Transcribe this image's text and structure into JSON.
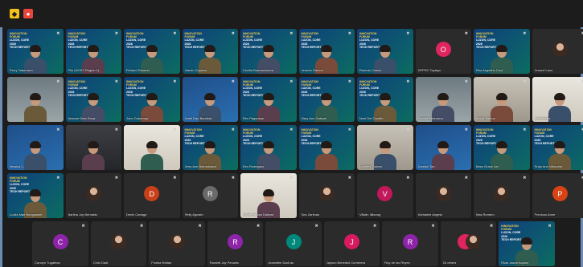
{
  "toolbar": {
    "shield_icon": "shield-icon",
    "record_icon": "record-icon"
  },
  "forum_banner": {
    "line1": "INNOVATION FORUM",
    "line2": "LUZON, CORE 2026",
    "line3": "TECH REPORT"
  },
  "rows": [
    [
      {
        "name": "Perry Tabernero",
        "type": "video",
        "bg": "forum"
      },
      {
        "name": "Pilo (DOST-Region 1)",
        "type": "video",
        "bg": "forum"
      },
      {
        "name": "Richard Rosario",
        "type": "video",
        "bg": "forum"
      },
      {
        "name": "Marvin Goyena",
        "type": "video",
        "bg": "forum"
      },
      {
        "name": "Cecilia Buenaventura",
        "type": "video",
        "bg": "forum"
      },
      {
        "name": "Jerome Ramos",
        "type": "video",
        "bg": "forum"
      },
      {
        "name": "Roberto Castro",
        "type": "video",
        "bg": "forum"
      },
      {
        "name": "DPPRC Taytayo",
        "type": "avatar",
        "letter": "O",
        "color": "#e0245e"
      },
      {
        "name": "Rea Angeline Cruz",
        "type": "video",
        "bg": "forum"
      },
      {
        "name": "Jemuel Lazo",
        "type": "photo"
      }
    ],
    [
      {
        "name": "",
        "type": "video",
        "bg": "room"
      },
      {
        "name": "Arianne Dela Rosa",
        "type": "video",
        "bg": "forum"
      },
      {
        "name": "John Caburnay",
        "type": "video",
        "bg": "forum"
      },
      {
        "name": "Jeriel Dan Bautista",
        "type": "video",
        "bg": "blue"
      },
      {
        "name": "Rex Pagsuban",
        "type": "video",
        "bg": "forum"
      },
      {
        "name": "Mary Ann Gabuat",
        "type": "video",
        "bg": "forum"
      },
      {
        "name": "Noel Del Castillo",
        "type": "video",
        "bg": "forum"
      },
      {
        "name": "Rachel Villanueva",
        "type": "video",
        "bg": "room"
      },
      {
        "name": "Maria Santos",
        "type": "video",
        "bg": "office"
      },
      {
        "name": "Ana Reyes",
        "type": "video",
        "bg": "light"
      }
    ],
    [
      {
        "name": "Jessica L.",
        "type": "video",
        "bg": "blue"
      },
      {
        "name": "",
        "type": "video",
        "bg": "dark"
      },
      {
        "name": "",
        "type": "video",
        "bg": "light"
      },
      {
        "name": "Jerry Ann Batumbakal",
        "type": "video",
        "bg": "forum"
      },
      {
        "name": "Kim Rodriguez",
        "type": "video",
        "bg": "forum"
      },
      {
        "name": "",
        "type": "video",
        "bg": "forum"
      },
      {
        "name": "Lourdes Galvez",
        "type": "video",
        "bg": "office"
      },
      {
        "name": "Jocelyn Tan",
        "type": "video",
        "bg": "blue"
      },
      {
        "name": "Mary Grace Lim",
        "type": "video",
        "bg": "forum"
      },
      {
        "name": "Ruby Ann Villacorta",
        "type": "video",
        "bg": "forum"
      }
    ],
    [
      {
        "name": "Lucila Mae Bongcawel",
        "type": "video",
        "bg": "forum"
      },
      {
        "name": "Barlina Joy Bernaldo",
        "type": "photo"
      },
      {
        "name": "Denis Cariaga",
        "type": "avatar",
        "letter": "D",
        "color": "#c8401a"
      },
      {
        "name": "Reily Agustin",
        "type": "avatar",
        "letter": "R",
        "color": "#6a6a6a"
      },
      {
        "name": "Rosie Piedad Dalmas",
        "type": "video",
        "bg": "light"
      },
      {
        "name": "Sea Zarlinas",
        "type": "photo"
      },
      {
        "name": "Villalin Ilillaung",
        "type": "avatar",
        "letter": "V",
        "color": "#c2185b"
      },
      {
        "name": "Michaelle Angela",
        "type": "photo"
      },
      {
        "name": "Nea Romero",
        "type": "photo"
      },
      {
        "name": "Precious Anne",
        "type": "avatar",
        "letter": "P",
        "color": "#d84315"
      }
    ],
    [
      {
        "name": "Carolyn Tugafnas",
        "type": "avatar",
        "letter": "C",
        "color": "#8e24aa"
      },
      {
        "name": "Chilo Dadi",
        "type": "photo"
      },
      {
        "name": "Florida Raltao",
        "type": "photo"
      },
      {
        "name": "Randell Jay Pecanto",
        "type": "avatar",
        "letter": "R",
        "color": "#8e24aa"
      },
      {
        "name": "Jeannilee Dadi ao",
        "type": "avatar",
        "letter": "J",
        "color": "#00897b"
      },
      {
        "name": "Jayson Benedict Cumbrera",
        "type": "avatar",
        "letter": "J",
        "color": "#d81b60"
      },
      {
        "name": "Roy de los Reyes",
        "type": "avatar",
        "letter": "R",
        "color": "#8e24aa"
      },
      {
        "name": "16 others",
        "type": "multi"
      },
      {
        "name": "Rizal Jason Aquino",
        "type": "video",
        "bg": "forum"
      }
    ]
  ]
}
